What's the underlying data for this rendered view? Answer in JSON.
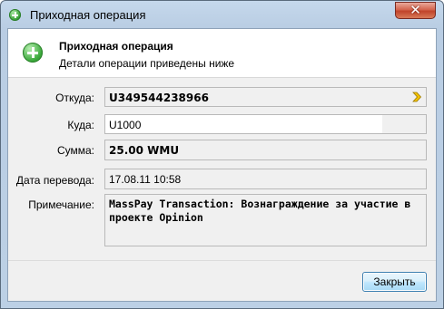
{
  "window": {
    "title": "Приходная операция",
    "close_glyph": "✕"
  },
  "header": {
    "title": "Приходная операция",
    "subtitle": "Детали операции приведены ниже"
  },
  "fields": {
    "from": {
      "label": "Откуда:",
      "value": "U349544238966"
    },
    "to": {
      "label": "Куда:",
      "value": "U1000"
    },
    "amount": {
      "label": "Сумма:",
      "value": "25.00 WMU"
    },
    "date": {
      "label": "Дата перевода:",
      "value": "17.08.11 10:58"
    },
    "note": {
      "label": "Примечание:",
      "value": "MassPay Transaction: Вознаграждение за участие в проекте Opinion"
    }
  },
  "footer": {
    "close_label": "Закрыть"
  },
  "colors": {
    "accent_green": "#3aa83a",
    "arrow_yellow": "#e8b400"
  },
  "icons": {
    "title": "plus-circle-icon",
    "header": "plus-circle-icon",
    "from_action": "chevron-right-icon"
  }
}
